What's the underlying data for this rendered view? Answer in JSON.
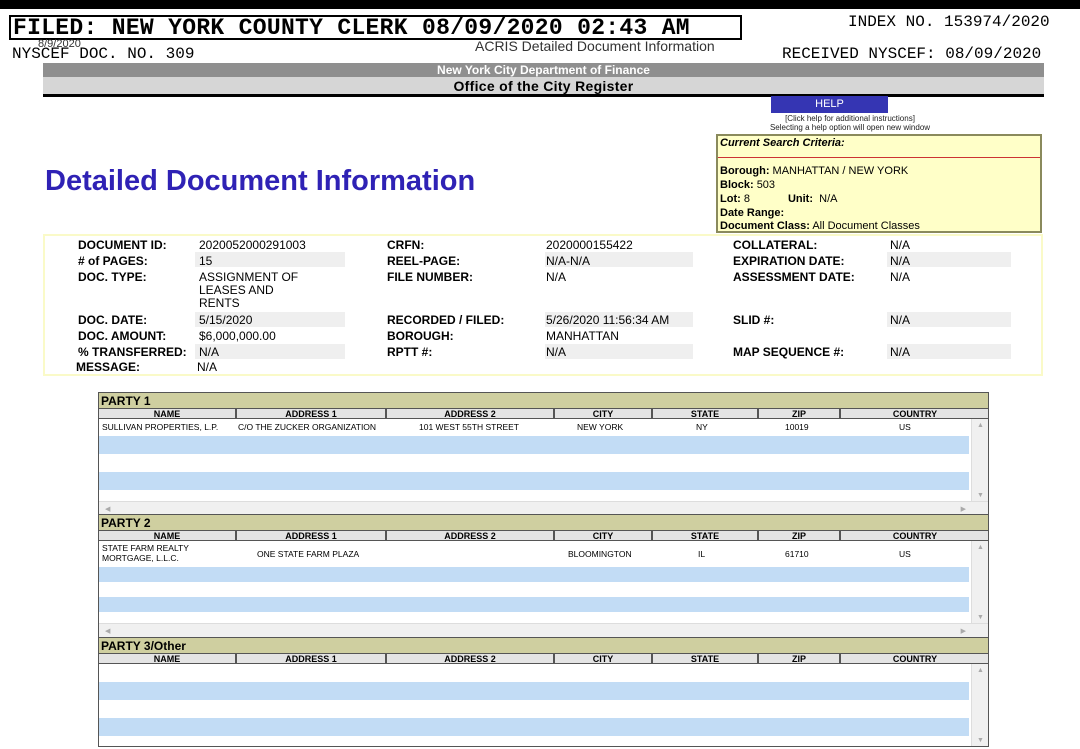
{
  "stamp": {
    "filed": "FILED: NEW YORK COUNTY CLERK 08/09/2020 02:43 AM",
    "index_no": "INDEX NO. 153974/2020",
    "nyscef_doc": "NYSCEF DOC. NO. 309",
    "small_date": "8/9/2020",
    "received": "RECEIVED NYSCEF: 08/09/2020"
  },
  "header": {
    "acris_title": "ACRIS Detailed Document Information",
    "department": "New York City Department of Finance",
    "office": "Office of the City Register"
  },
  "help": {
    "button": "HELP",
    "note_line1": "[Click help for additional instructions]",
    "note_line2": "Selecting a help option will open new window"
  },
  "criteria": {
    "heading": "Current Search Criteria:",
    "borough_label": "Borough:",
    "borough": "MANHATTAN / NEW YORK",
    "block_label": "Block:",
    "block": "503",
    "lot_label": "Lot:",
    "lot": "8",
    "unit_label": "Unit:",
    "unit": "N/A",
    "date_range_label": "Date Range:",
    "doc_class_label": "Document Class:",
    "doc_class": "All Document Classes"
  },
  "page_title": "Detailed Document Information",
  "document": {
    "doc_id_label": "DOCUMENT ID:",
    "doc_id": "2020052000291003",
    "pages_label": "# of PAGES:",
    "pages": "15",
    "doc_type_label": "DOC. TYPE:",
    "doc_type_1": "ASSIGNMENT OF",
    "doc_type_2": "LEASES AND",
    "doc_type_3": "RENTS",
    "doc_date_label": "DOC. DATE:",
    "doc_date": "5/15/2020",
    "doc_amount_label": "DOC. AMOUNT:",
    "doc_amount": "$6,000,000.00",
    "transferred_label": "% TRANSFERRED:",
    "transferred": "N/A",
    "message_label": "MESSAGE:",
    "message": "N/A",
    "crfn_label": "CRFN:",
    "crfn": "2020000155422",
    "reel_label": "REEL-PAGE:",
    "reel": "N/A-N/A",
    "file_label": "FILE NUMBER:",
    "file": "N/A",
    "recorded_label": "RECORDED / FILED:",
    "recorded": "5/26/2020 11:56:34 AM",
    "borough_label": "BOROUGH:",
    "borough": "MANHATTAN",
    "rptt_label": "RPTT #:",
    "rptt": "N/A",
    "collateral_label": "COLLATERAL:",
    "collateral": "N/A",
    "expiration_label": "EXPIRATION DATE:",
    "expiration": "N/A",
    "assessment_label": "ASSESSMENT DATE:",
    "assessment": "N/A",
    "slid_label": "SLID #:",
    "slid": "N/A",
    "map_label": "MAP SEQUENCE #:",
    "map": "N/A"
  },
  "columns": [
    "NAME",
    "ADDRESS 1",
    "ADDRESS 2",
    "CITY",
    "STATE",
    "ZIP",
    "COUNTRY"
  ],
  "parties": [
    {
      "title": "PARTY 1",
      "name_1": "SULLIVAN PROPERTIES, L.P.",
      "name_2": "",
      "address1": "C/O THE ZUCKER ORGANIZATION",
      "address2": "101 WEST 55TH STREET",
      "city": "NEW YORK",
      "state": "NY",
      "zip": "10019",
      "country": "US"
    },
    {
      "title": "PARTY 2",
      "name_1": "STATE FARM REALTY",
      "name_2": "MORTGAGE, L.L.C.",
      "address1": "ONE STATE FARM PLAZA",
      "address2": "",
      "city": "BLOOMINGTON",
      "state": "IL",
      "zip": "61710",
      "country": "US"
    },
    {
      "title": "PARTY 3/Other",
      "name_1": "",
      "name_2": "",
      "address1": "",
      "address2": "",
      "city": "",
      "state": "",
      "zip": "",
      "country": ""
    }
  ]
}
